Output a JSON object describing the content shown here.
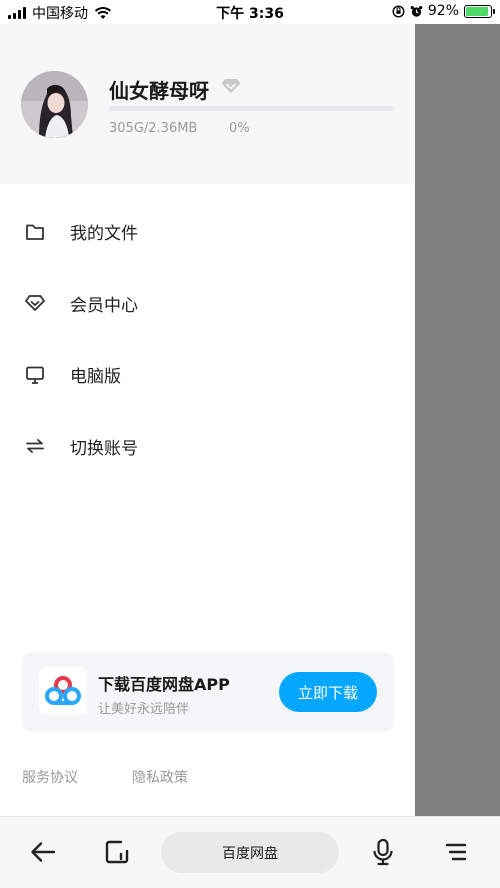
{
  "status_bar": {
    "carrier": "中国移动",
    "time": "下午 3:36",
    "battery_percent": "92%",
    "battery_level": 0.92
  },
  "profile": {
    "username": "仙女酵母呀",
    "quota": "305G/2.36MB",
    "quota_percent": "0%",
    "quota_fill": 0.0,
    "vip_icon": "diamond-icon"
  },
  "menu": {
    "items": [
      {
        "label": "我的文件",
        "icon": "folder-icon"
      },
      {
        "label": "会员中心",
        "icon": "diamond-icon"
      },
      {
        "label": "电脑版",
        "icon": "monitor-icon"
      },
      {
        "label": "切换账号",
        "icon": "switch-arrows-icon"
      }
    ]
  },
  "promo": {
    "title": "下载百度网盘APP",
    "subtitle": "让美好永远陪伴",
    "button": "立即下载",
    "accent": "#06a7ff"
  },
  "legal": {
    "terms": "服务协议",
    "privacy": "隐私政策"
  },
  "browser_bar": {
    "title": "百度网盘",
    "icons": [
      "back-arrow-icon",
      "tabs-icon",
      "microphone-icon",
      "menu-icon"
    ]
  }
}
